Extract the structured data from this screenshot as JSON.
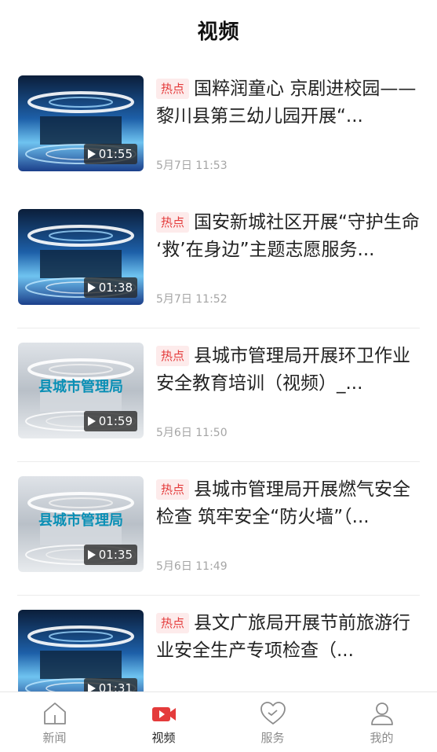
{
  "header": {
    "title": "视频"
  },
  "colors": {
    "accent": "#e43b3b",
    "hot_tag_bg": "#fdebeb",
    "date": "#a5a5a5",
    "tab_inactive": "#8c8c8c"
  },
  "videos": [
    {
      "tag": "热点",
      "title": "国粹润童心 京剧进校园——黎川县第三幼儿园开展“...",
      "duration": "01:55",
      "date": "5月7日 11:53",
      "thumb_style": "studio-blue",
      "thumb_text": ""
    },
    {
      "tag": "热点",
      "title": "国安新城社区开展“守护生命 ‘救’在身边”主题志愿服务...",
      "duration": "01:38",
      "date": "5月7日 11:52",
      "thumb_style": "studio-blue",
      "thumb_text": ""
    },
    {
      "tag": "热点",
      "title": "县城市管理局开展环卫作业安全教育培训（视频）_...",
      "duration": "01:59",
      "date": "5月6日 11:50",
      "thumb_style": "studio-grey",
      "thumb_text": "县城市管理局"
    },
    {
      "tag": "热点",
      "title": "县城市管理局开展燃气安全检查 筑牢安全“防火墙”（...",
      "duration": "01:35",
      "date": "5月6日 11:49",
      "thumb_style": "studio-grey",
      "thumb_text": "县城市管理局"
    },
    {
      "tag": "热点",
      "title": "县文广旅局开展节前旅游行业安全生产专项检查（...",
      "duration": "01:31",
      "date": "",
      "thumb_style": "studio-blue",
      "thumb_text": ""
    }
  ],
  "tabs": [
    {
      "label": "新闻",
      "icon": "home-icon",
      "active": false
    },
    {
      "label": "视频",
      "icon": "video-camera-icon",
      "active": true
    },
    {
      "label": "服务",
      "icon": "heart-icon",
      "active": false
    },
    {
      "label": "我的",
      "icon": "person-icon",
      "active": false
    }
  ]
}
